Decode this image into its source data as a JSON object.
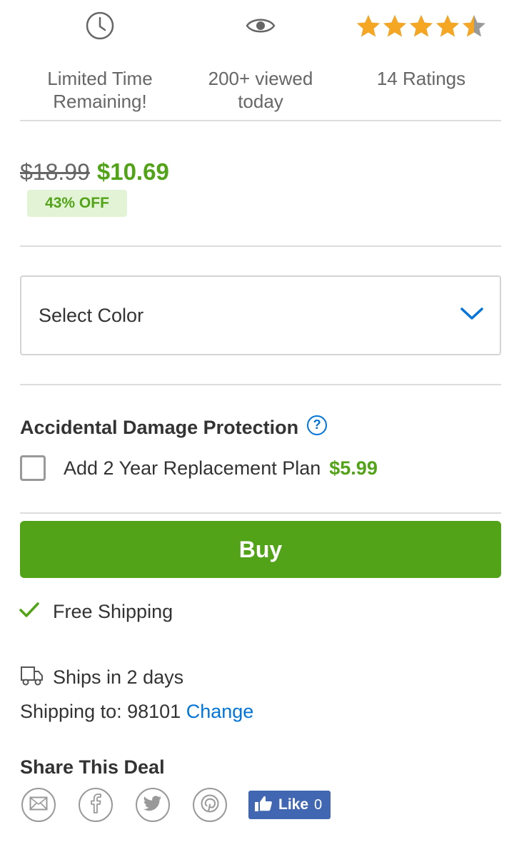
{
  "stats": {
    "time_label": "Limited Time\nRemaining!",
    "views_label": "200+ viewed\ntoday",
    "ratings_label": "14 Ratings",
    "rating_value": 4.5,
    "rating_max": 5,
    "star_color": "#f5a623"
  },
  "price": {
    "original": "$18.99",
    "current": "$10.69",
    "discount": "43% OFF"
  },
  "color_select": {
    "label": "Select Color",
    "icon": "chevron-down-icon"
  },
  "protection": {
    "title": "Accidental Damage Protection",
    "help_icon": "?",
    "plan_label": "Add 2 Year Replacement Plan",
    "plan_price": "$5.99",
    "checked": false
  },
  "buy_button": {
    "label": "Buy"
  },
  "shipping": {
    "free_label": "Free Shipping",
    "ships_label": "Ships in 2 days",
    "to_label": "Shipping to: 98101",
    "change_link": "Change"
  },
  "share": {
    "title": "Share This Deal",
    "icons": [
      "email-icon",
      "facebook-icon",
      "twitter-icon",
      "pinterest-icon"
    ],
    "like_label": "Like",
    "like_count": "0"
  },
  "colors": {
    "accent_green": "#53a318",
    "link_blue": "#0074d9",
    "facebook_blue": "#4267b2"
  }
}
